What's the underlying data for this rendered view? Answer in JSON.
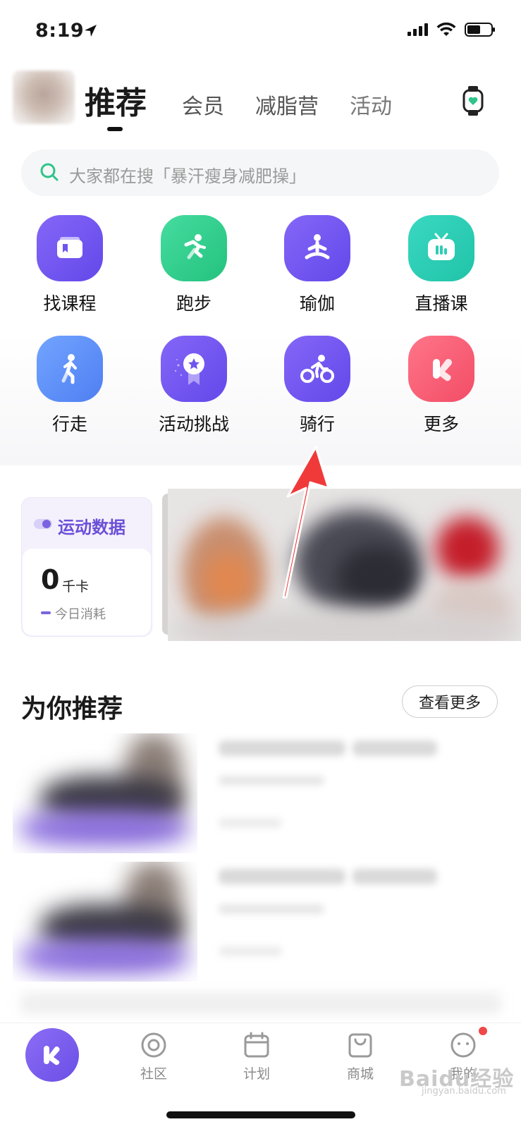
{
  "status_bar": {
    "time": "8:19"
  },
  "tabs": {
    "active": "推荐",
    "items": [
      "会员",
      "减脂营",
      "活动"
    ]
  },
  "search": {
    "placeholder": "大家都在搜「暴汗瘦身减肥操」"
  },
  "grid": [
    {
      "label": "找课程",
      "icon": "course-icon",
      "color": "#6e55f0"
    },
    {
      "label": "跑步",
      "icon": "running-icon",
      "color": "#34d08c"
    },
    {
      "label": "瑜伽",
      "icon": "yoga-icon",
      "color": "#6e55f0"
    },
    {
      "label": "直播课",
      "icon": "live-tv-icon",
      "color": "#2dcdb4"
    },
    {
      "label": "行走",
      "icon": "walking-icon",
      "color": "#5a8cf8"
    },
    {
      "label": "活动挑战",
      "icon": "medal-icon",
      "color": "#6e55f0"
    },
    {
      "label": "骑行",
      "icon": "cycling-icon",
      "color": "#6e55f0"
    },
    {
      "label": "更多",
      "icon": "k-logo-icon",
      "color": "#f56275"
    }
  ],
  "sport_data": {
    "title": "运动数据",
    "value": "0",
    "unit": "千卡",
    "sub_label": "今日消耗"
  },
  "recommend": {
    "title": "为你推荐",
    "more_label": "查看更多"
  },
  "bottom_nav": [
    {
      "label": "社区",
      "icon": "community-icon"
    },
    {
      "label": "计划",
      "icon": "calendar-icon"
    },
    {
      "label": "商城",
      "icon": "shop-bag-icon"
    },
    {
      "label": "我的",
      "icon": "profile-face-icon"
    }
  ],
  "colors": {
    "accent": "#6e55f0",
    "annotation": "#f03a3a"
  },
  "watermark": {
    "brand": "Baidu经验",
    "url": "jingyan.baidu.com"
  }
}
